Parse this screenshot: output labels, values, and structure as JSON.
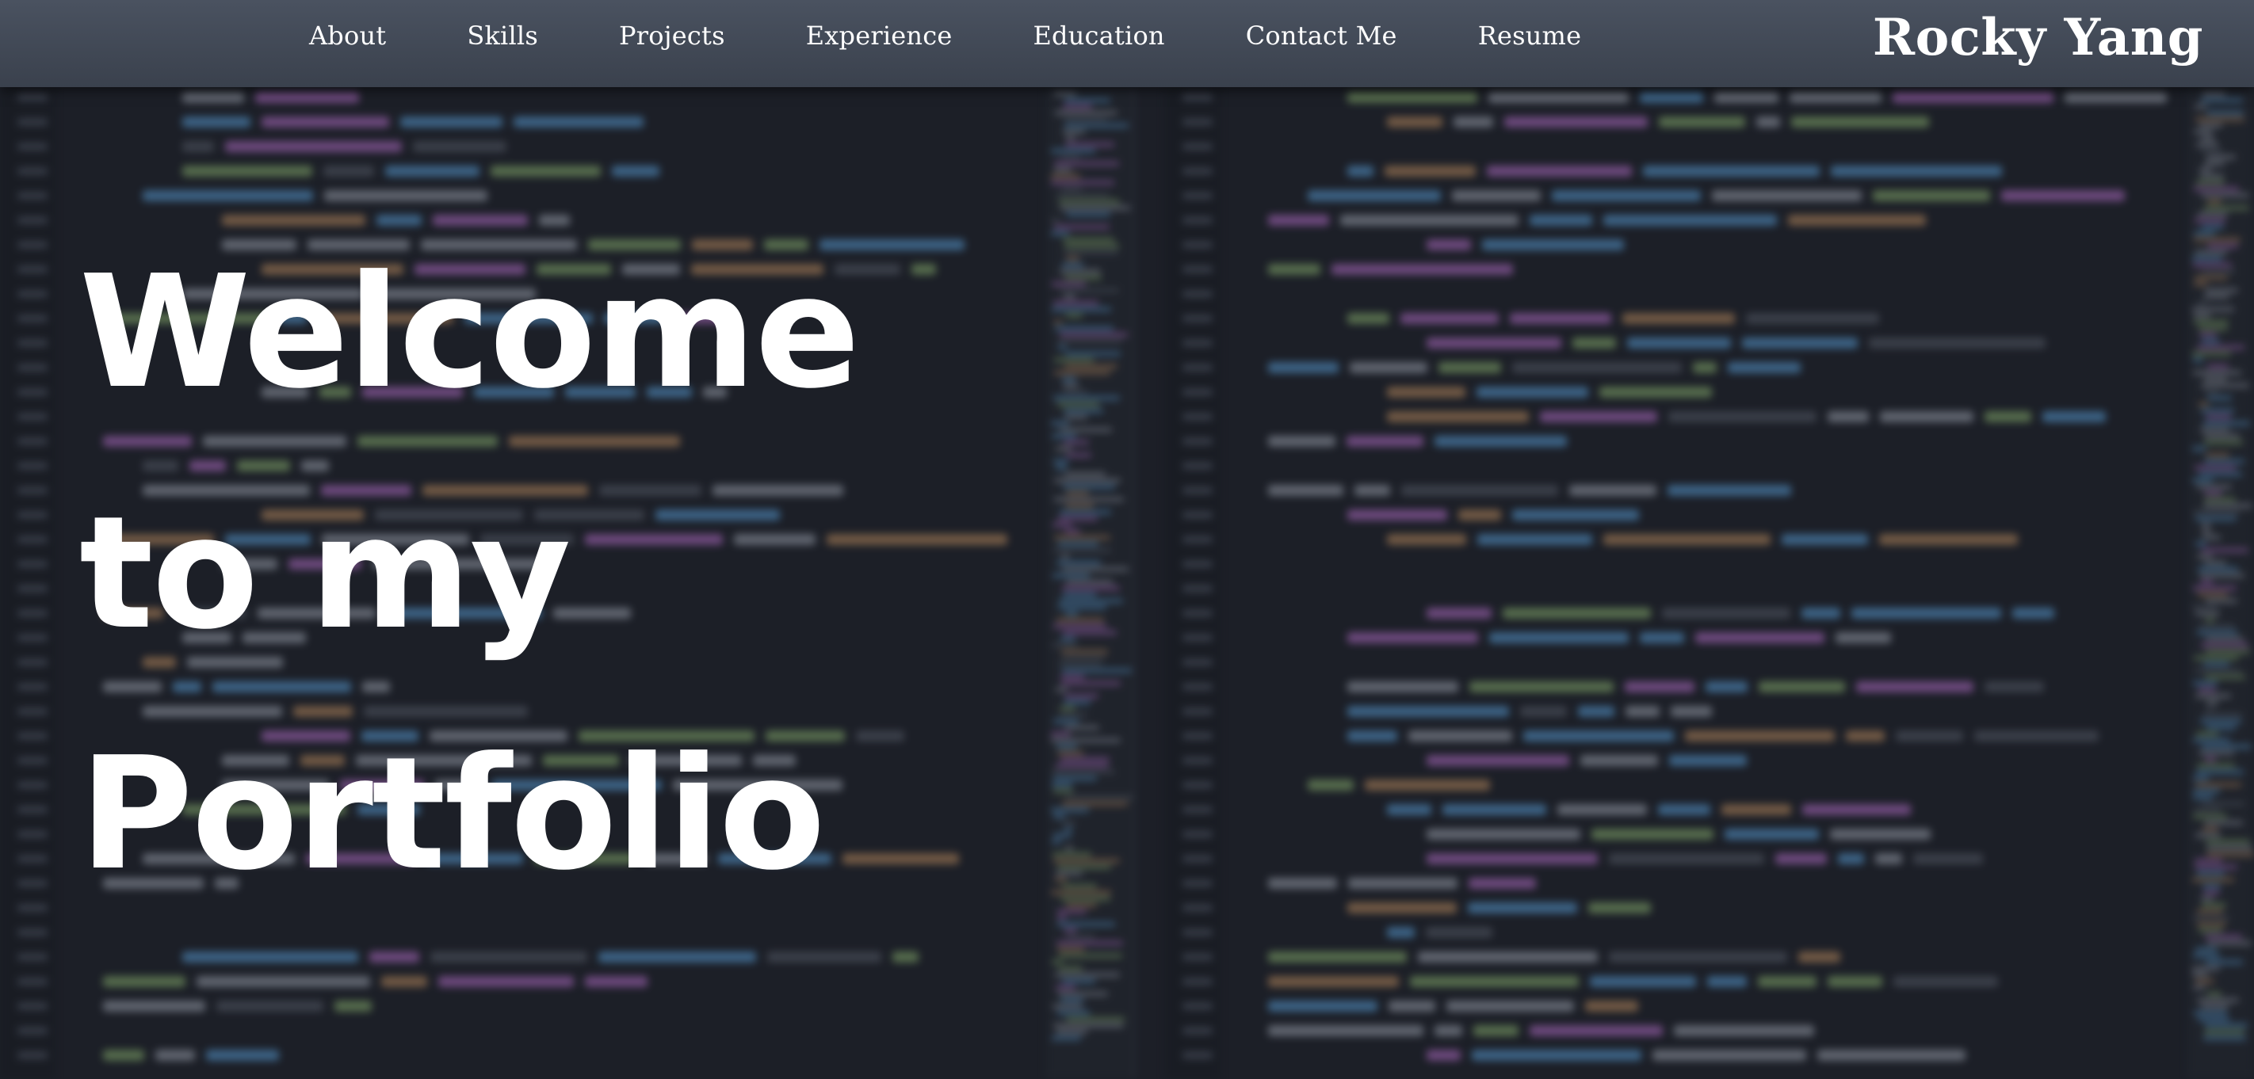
{
  "nav": {
    "links": [
      {
        "label": "About"
      },
      {
        "label": "Skills"
      },
      {
        "label": "Projects"
      },
      {
        "label": "Experience"
      },
      {
        "label": "Education"
      },
      {
        "label": "Contact Me"
      },
      {
        "label": "Resume"
      }
    ],
    "brand": "Rocky Yang"
  },
  "hero": {
    "lines": [
      "Welcome",
      "to my",
      "Portfolio"
    ]
  },
  "colors": {
    "background": "#1c1f27",
    "navbar": "#434a57",
    "text": "#ffffff",
    "code_keyword": "#c678dd",
    "code_function": "#61afef",
    "code_string": "#98c379",
    "code_number": "#d19a66",
    "code_plain": "#abb2bf",
    "code_comment": "#5c6370"
  }
}
